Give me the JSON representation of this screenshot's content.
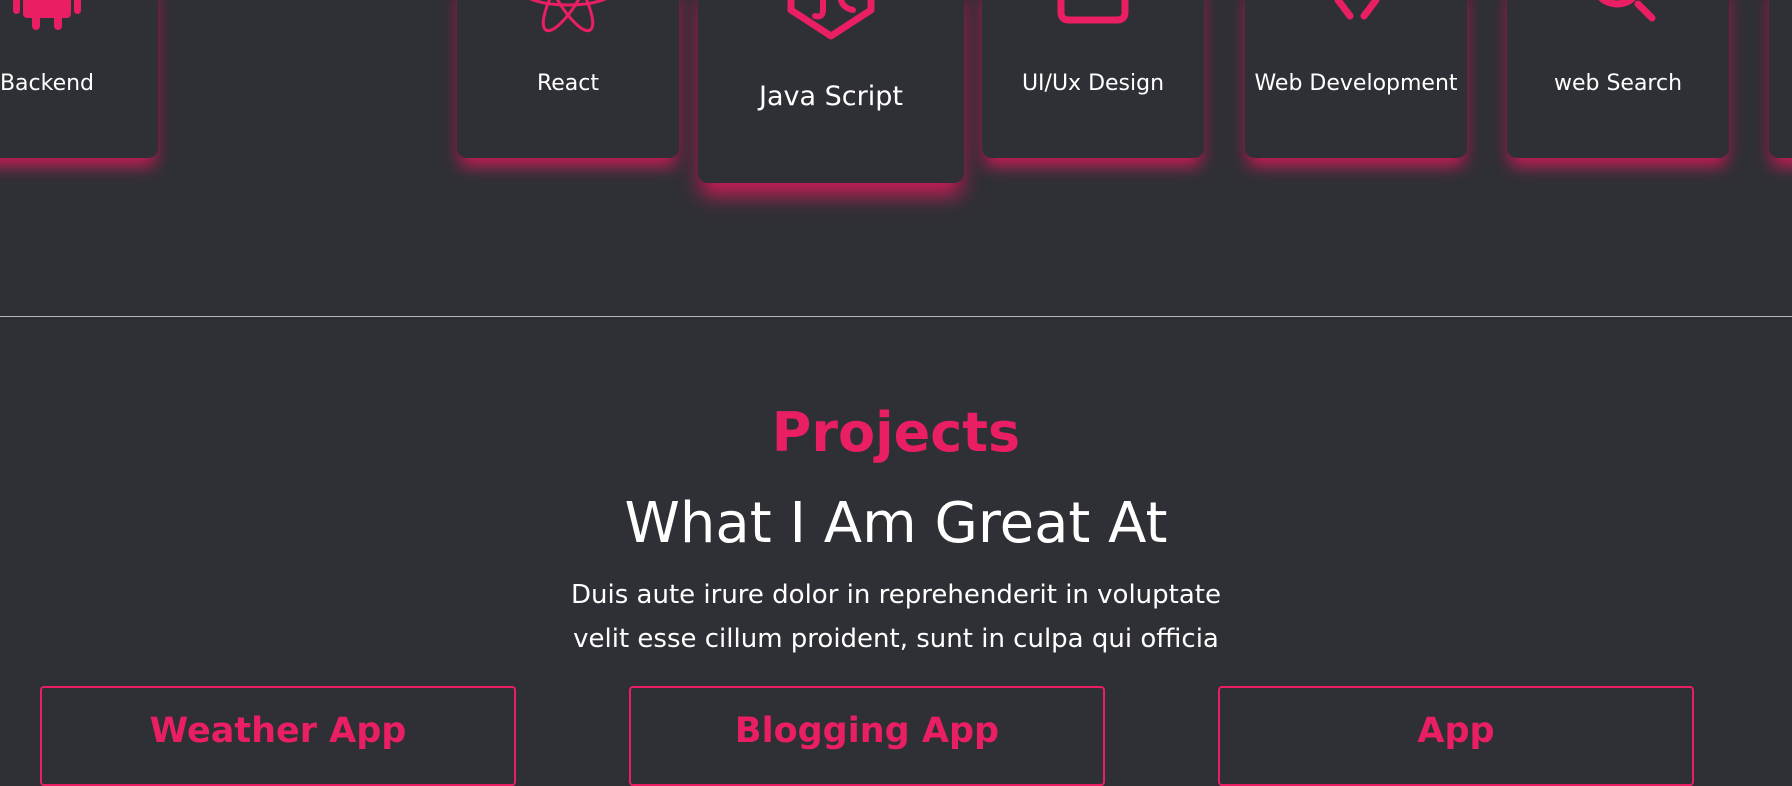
{
  "skills": [
    {
      "label": "Backend",
      "icon": "android-icon"
    },
    {
      "label": "React",
      "icon": "react-icon"
    },
    {
      "label": "Java Script",
      "icon": "javascript-icon"
    },
    {
      "label": "UI/Ux Design",
      "icon": "design-frame-icon"
    },
    {
      "label": "Web Development",
      "icon": "code-icon"
    },
    {
      "label": "web Search",
      "icon": "search-icon"
    }
  ],
  "projects": {
    "title": "Projects",
    "subtitle": "What I Am Great At",
    "description": "Duis aute irure dolor in reprehenderit in voluptate velit esse cillum proident, sunt in culpa qui officia",
    "cards": [
      {
        "title": "Weather App"
      },
      {
        "title": "Blogging App"
      },
      {
        "title": "App"
      }
    ]
  },
  "colors": {
    "accent": "#e91e63",
    "background": "#2f3036",
    "text": "#ffffff",
    "divider": "#b7b7bb"
  }
}
